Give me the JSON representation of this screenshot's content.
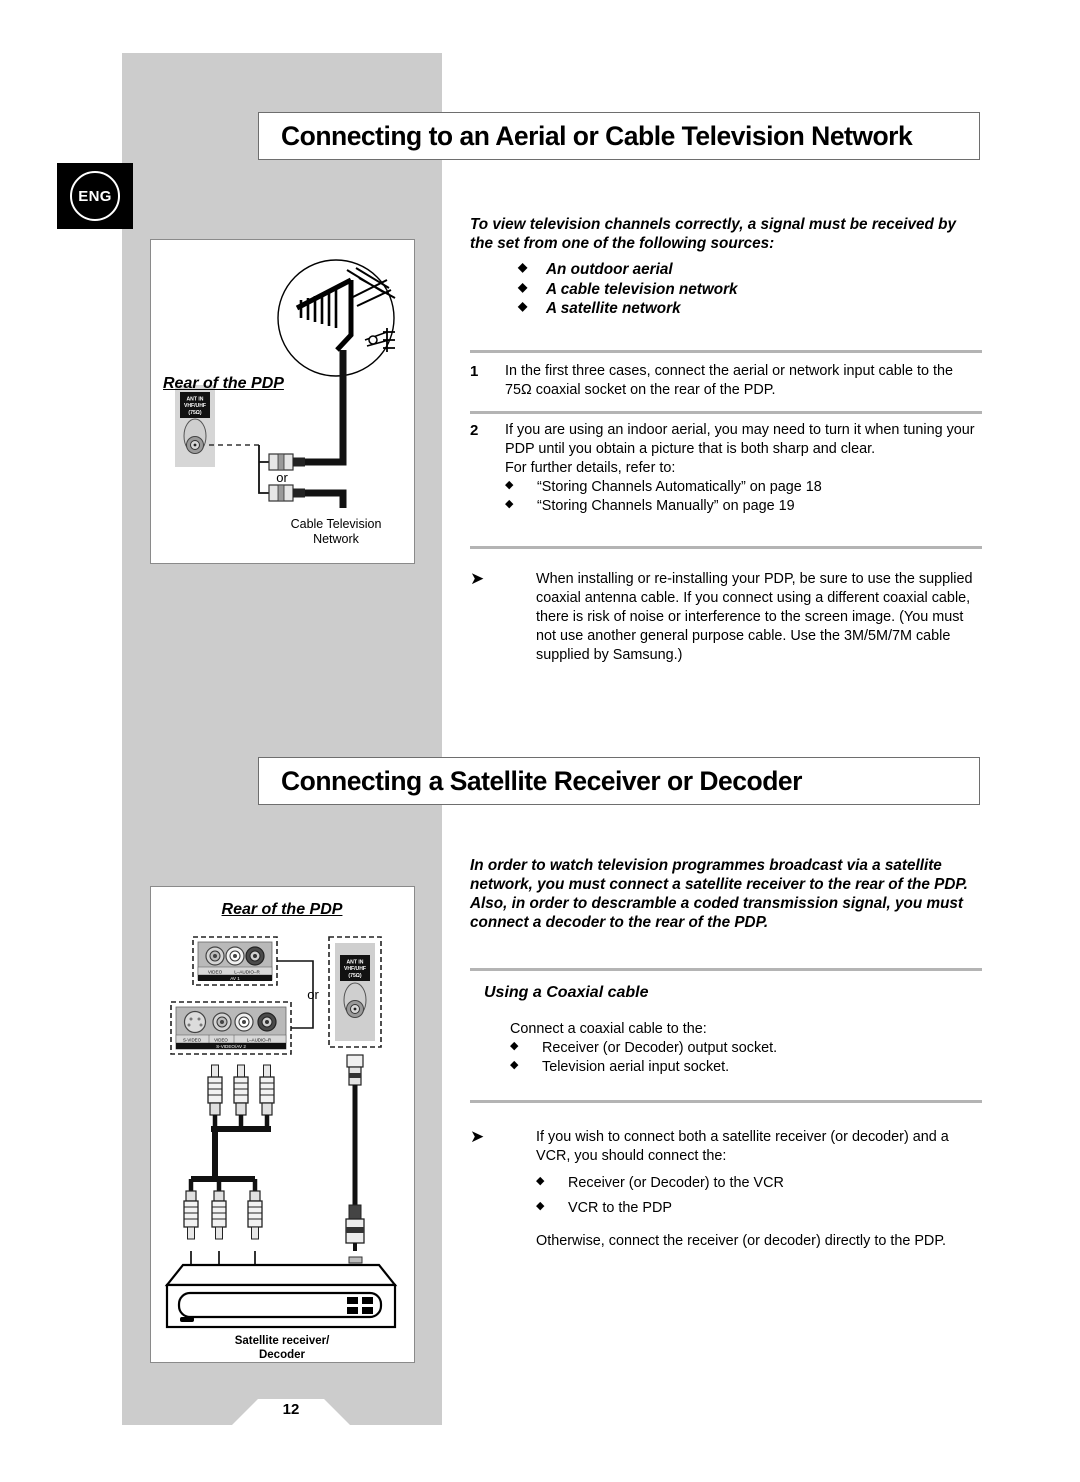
{
  "page": {
    "number": "12",
    "language_badge": "ENG"
  },
  "sections": [
    {
      "heading": "Connecting to an Aerial or Cable Television Network",
      "intro": "To view television channels correctly, a signal must be received by the set from one of the following sources:",
      "intro_items": [
        "An outdoor aerial",
        "A cable television network",
        "A satellite network"
      ],
      "steps": [
        {
          "number": "1",
          "text": "In the first three cases, connect the aerial or network input cable to the 75Ω coaxial socket on the rear of the PDP.",
          "sub_intro": "",
          "sub_items": []
        },
        {
          "number": "2",
          "text": "If you are using an indoor aerial, you may need to turn it when tuning your PDP until you obtain a picture that is both sharp and clear.",
          "sub_intro": "For further details, refer to:",
          "sub_items": [
            "“Storing Channels Automatically” on page 18",
            "“Storing Channels Manually” on page 19"
          ]
        }
      ],
      "note": {
        "text": "When installing or re-installing your PDP, be sure to use the supplied coaxial antenna cable. If you connect using a different coaxial cable, there is risk of noise or interference to the screen image. (You must not use another general purpose cable. Use the 3M/5M/7M cable supplied by Samsung.)"
      },
      "figure": {
        "title": "Rear of the PDP",
        "or_label": "or",
        "caption": "Cable Television\nNetwork",
        "socket": {
          "line1": "ANT IN",
          "line2": "VHF/UHF",
          "line3": "(75Ω)"
        }
      }
    },
    {
      "heading": "Connecting a Satellite Receiver or Decoder",
      "intro": "In order to watch television programmes broadcast via a satellite network, you must connect a satellite receiver to the rear of the PDP. Also, in order to descramble a coded transmission signal, you must connect a decoder to the rear of the PDP.",
      "subhead": "Using a Coaxial cable",
      "body_intro": "Connect a coaxial cable to the:",
      "body_items": [
        "Receiver (or Decoder) output socket.",
        "Television aerial input socket."
      ],
      "note": {
        "intro": "If you wish to connect both a satellite receiver (or decoder) and a VCR, you should connect the:",
        "items": [
          "Receiver (or Decoder) to the VCR",
          "VCR to the PDP"
        ],
        "outro": "Otherwise, connect the receiver (or decoder) directly to the PDP."
      },
      "figure": {
        "title": "Rear of the PDP",
        "or_label": "or",
        "caption_line1": "Satellite receiver/",
        "caption_line2": "Decoder",
        "av1": {
          "video": "VIDEO",
          "audio": "L–AUDIO–R",
          "name": "AV 1"
        },
        "av2": {
          "svideo": "S-VIDEO",
          "video": "VIDEO",
          "audio": "L–AUDIO–R",
          "name": "S-VIDEO/AV 2"
        },
        "socket": {
          "line1": "ANT IN",
          "line2": "VHF/UHF",
          "line3": "(75Ω)"
        }
      }
    }
  ],
  "bullets": {
    "diamond": "◆",
    "arrow": "➤"
  }
}
